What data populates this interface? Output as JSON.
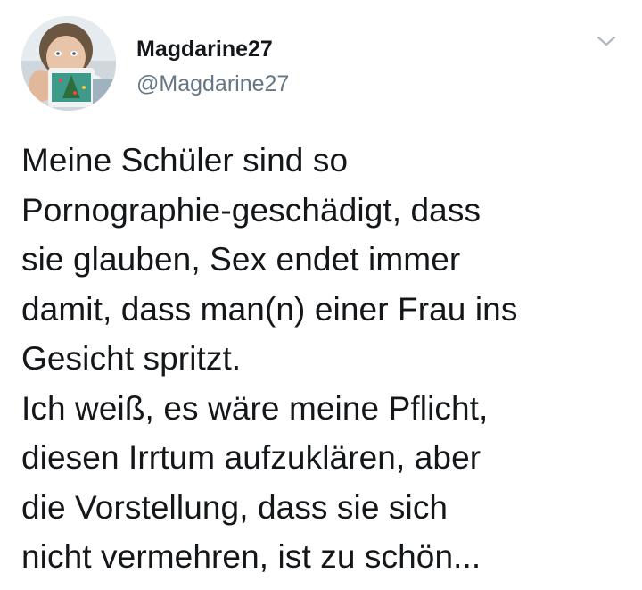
{
  "tweet": {
    "author": {
      "display_name": "Magdarine27",
      "handle": "@Magdarine27",
      "avatar_icon": "profile-photo-with-mug"
    },
    "menu_icon": "chevron-down-icon",
    "text_lines": [
      "Meine Schüler sind so",
      "Pornographie-geschädigt, dass",
      "sie glauben, Sex endet immer",
      "damit, dass man(n) einer Frau ins",
      "Gesicht spritzt.",
      "Ich weiß, es wäre meine Pflicht,",
      "diesen Irrtum aufzuklären, aber",
      "die Vorstellung, dass sie sich",
      "nicht vermehren, ist zu schön..."
    ],
    "colors": {
      "text": "#14171a",
      "secondary": "#657786",
      "background": "#ffffff"
    }
  }
}
